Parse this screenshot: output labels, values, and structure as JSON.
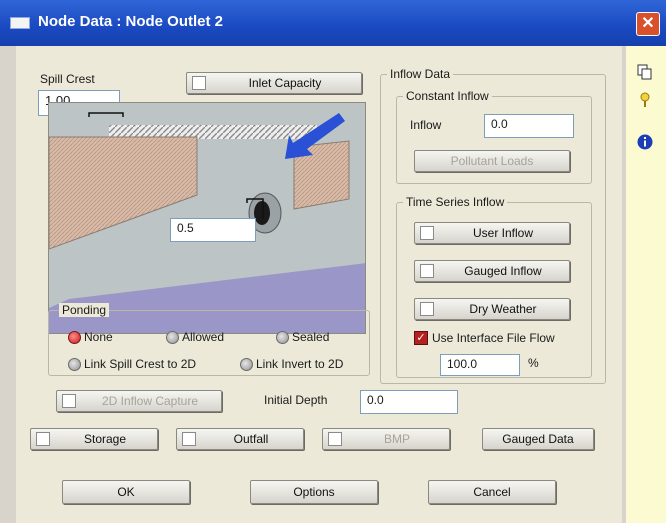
{
  "window": {
    "title": "Node Data : Node Outlet 2",
    "close_glyph": "✕"
  },
  "spill_crest": {
    "label": "Spill Crest",
    "value": "1.00"
  },
  "inlet_capacity": {
    "label": "Inlet Capacity"
  },
  "invert_value": "0.5",
  "inflow_data": {
    "group_label": "Inflow Data",
    "constant_inflow": {
      "group_label": "Constant Inflow",
      "inflow_label": "Inflow",
      "inflow_value": "0.0",
      "pollutant_loads_label": "Pollutant Loads"
    },
    "time_series_inflow": {
      "group_label": "Time Series Inflow",
      "user_inflow_label": "User Inflow",
      "gauged_inflow_label": "Gauged Inflow",
      "dry_weather_label": "Dry Weather",
      "use_interface_label": "Use Interface File Flow",
      "percent_value": "100.0",
      "percent_unit": "%"
    }
  },
  "ponding": {
    "group_label": "Ponding",
    "options": {
      "none": "None",
      "allowed": "Allowed",
      "sealed": "Sealed",
      "link_spill": "Link Spill Crest to 2D",
      "link_invert": "Link Invert to 2D"
    },
    "selected": "None"
  },
  "twod_inflow_capture_label": "2D Inflow Capture",
  "initial_depth": {
    "label": "Initial Depth",
    "value": "0.0"
  },
  "bottom_buttons": {
    "storage": "Storage",
    "outfall": "Outfall",
    "bmp": "BMP",
    "gauged_data": "Gauged Data"
  },
  "actions": {
    "ok": "OK",
    "options": "Options",
    "cancel": "Cancel"
  },
  "side_icons": [
    "copy-icon",
    "pin-icon",
    "info-icon"
  ],
  "colors": {
    "titlebar": "#1a49c1",
    "dialog_bg": "#ece9d8",
    "side_pane": "#fbfad0",
    "diagram_water": "#9b96c8",
    "diagram_wall": "#d6b9a6",
    "arrow": "#2a50d6",
    "radio_selected": "#c41b1b"
  }
}
